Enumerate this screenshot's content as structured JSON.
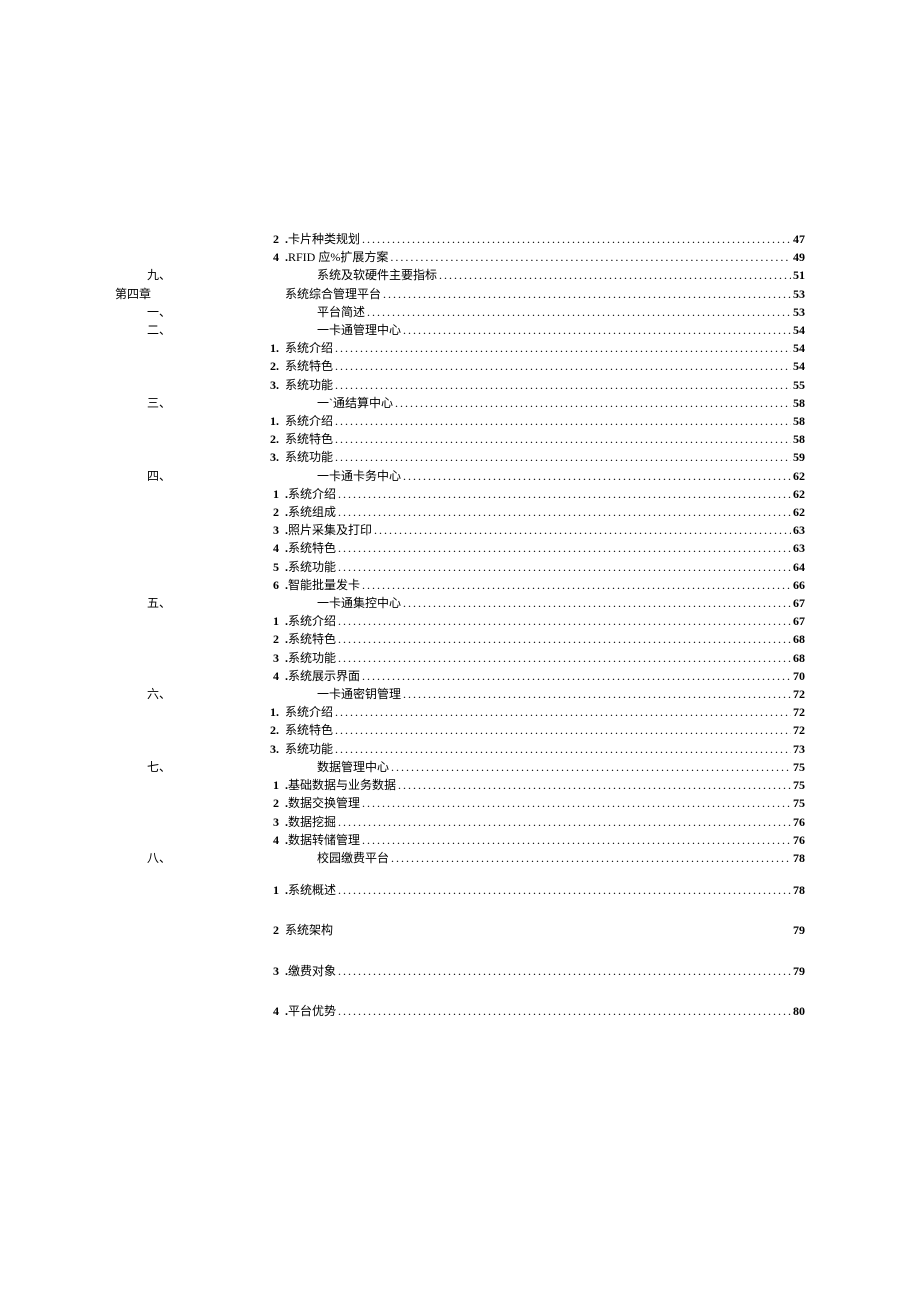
{
  "toc": [
    {
      "label": "2",
      "labelClass": "label-subnum num-bold",
      "prefix": ".",
      "title": "卡片种类规划",
      "page": "47"
    },
    {
      "label": "4",
      "labelClass": "label-subnum num-bold",
      "prefix": ".",
      "title": "RFID 应%扩展方案",
      "page": "49"
    },
    {
      "label": "九、",
      "labelClass": "label-section section-text",
      "prefix": "",
      "title": "系统及软硬件主要指标",
      "page": "51"
    },
    {
      "label": "第四章",
      "labelClass": "label-chapter",
      "prefix": "",
      "title": "系统综合管理平台",
      "page": "53"
    },
    {
      "label": "一、",
      "labelClass": "label-section section-text",
      "prefix": "",
      "title": "平台简述",
      "page": "53"
    },
    {
      "label": "二、",
      "labelClass": "label-section section-text",
      "prefix": "",
      "title": "一卡通管理中心",
      "page": "54"
    },
    {
      "label": "1.",
      "labelClass": "label-subnum num-bold",
      "prefix": "",
      "title": "系统介绍",
      "page": "54"
    },
    {
      "label": "2.",
      "labelClass": "label-subnum num-bold",
      "prefix": "",
      "title": "系统特色",
      "page": "54"
    },
    {
      "label": "3.",
      "labelClass": "label-subnum num-bold",
      "prefix": "",
      "title": "系统功能",
      "page": "55"
    },
    {
      "label": "三、",
      "labelClass": "label-section section-text",
      "prefix": "",
      "title": "一`通结算中心",
      "page": "58"
    },
    {
      "label": "1.",
      "labelClass": "label-subnum num-bold",
      "prefix": "",
      "title": "系统介绍",
      "page": "58"
    },
    {
      "label": "2.",
      "labelClass": "label-subnum num-bold",
      "prefix": "",
      "title": "系统特色",
      "page": "58"
    },
    {
      "label": "3.",
      "labelClass": "label-subnum num-bold",
      "prefix": "",
      "title": "系统功能",
      "page": "59"
    },
    {
      "label": "四、",
      "labelClass": "label-section section-text",
      "prefix": "",
      "title": "一卡通卡务中心",
      "page": "62"
    },
    {
      "label": "1",
      "labelClass": "label-subnum num-bold",
      "prefix": ".",
      "title": "系统介绍",
      "page": "62"
    },
    {
      "label": "2",
      "labelClass": "label-subnum num-bold",
      "prefix": ".",
      "title": "系统组成",
      "page": "62"
    },
    {
      "label": "3",
      "labelClass": "label-subnum num-bold",
      "prefix": ".",
      "title": "照片采集及打印",
      "page": "63"
    },
    {
      "label": "4",
      "labelClass": "label-subnum num-bold",
      "prefix": ".",
      "title": "系统特色",
      "page": "63"
    },
    {
      "label": "5",
      "labelClass": "label-subnum num-bold",
      "prefix": ".",
      "title": "系统功能",
      "page": "64"
    },
    {
      "label": "6",
      "labelClass": "label-subnum num-bold",
      "prefix": ".",
      "title": "智能批量发卡",
      "page": "66"
    },
    {
      "label": "五、",
      "labelClass": "label-section section-text",
      "prefix": "",
      "title": "一卡通集控中心",
      "page": "67"
    },
    {
      "label": "1",
      "labelClass": "label-subnum num-bold",
      "prefix": ".",
      "title": "系统介绍",
      "page": "67"
    },
    {
      "label": "2",
      "labelClass": "label-subnum num-bold",
      "prefix": ".",
      "title": "系统特色",
      "page": "68"
    },
    {
      "label": "3",
      "labelClass": "label-subnum num-bold",
      "prefix": ".",
      "title": "系统功能",
      "page": "68"
    },
    {
      "label": "4",
      "labelClass": "label-subnum num-bold",
      "prefix": ".",
      "title": "系统展示界面",
      "page": "70"
    },
    {
      "label": "六、",
      "labelClass": "label-section section-text",
      "prefix": "",
      "title": "一卡通密钥管理",
      "page": "72"
    },
    {
      "label": "1.",
      "labelClass": "label-subnum num-bold",
      "prefix": "",
      "title": "系统介绍",
      "page": "72"
    },
    {
      "label": "2.",
      "labelClass": "label-subnum num-bold",
      "prefix": "",
      "title": "系统特色",
      "page": "72"
    },
    {
      "label": "3.",
      "labelClass": "label-subnum num-bold",
      "prefix": "",
      "title": "系统功能",
      "page": "73"
    },
    {
      "label": "七、",
      "labelClass": "label-section section-text",
      "prefix": "",
      "title": "数据管理中心",
      "page": "75"
    },
    {
      "label": "1",
      "labelClass": "label-subnum num-bold",
      "prefix": ".",
      "title": "基础数据与业务数据",
      "page": "75"
    },
    {
      "label": "2",
      "labelClass": "label-subnum num-bold",
      "prefix": ".",
      "title": "数据交换管理",
      "page": "75"
    },
    {
      "label": "3",
      "labelClass": "label-subnum num-bold",
      "prefix": ".",
      "title": "数据挖掘",
      "page": "76"
    },
    {
      "label": "4",
      "labelClass": "label-subnum num-bold",
      "prefix": ".",
      "title": "数据转储管理",
      "page": "76"
    },
    {
      "label": "八、",
      "labelClass": "label-section section-text",
      "prefix": "",
      "title": "校园缴费平台",
      "page": "78"
    },
    {
      "label": "1",
      "labelClass": "label-subnum num-bold",
      "prefix": ".",
      "title": "系统概述",
      "page": "78",
      "gap": "gap-top"
    },
    {
      "label": "2",
      "labelClass": "label-subnum num-bold",
      "prefix": "",
      "title": "系统架构",
      "page": "79",
      "gap": "gap-top-lg",
      "noleader": true
    },
    {
      "label": "3",
      "labelClass": "label-subnum num-bold",
      "prefix": ".",
      "title": "缴费对象",
      "page": "79",
      "gap": "gap-top-lg"
    },
    {
      "label": "4",
      "labelClass": "label-subnum num-bold",
      "prefix": ".",
      "title": "平台优势",
      "page": "80",
      "gap": "gap-top-lg"
    }
  ]
}
